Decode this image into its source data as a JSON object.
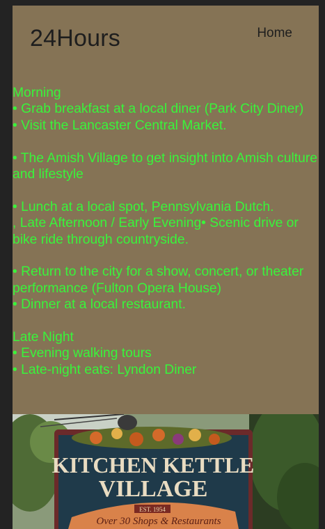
{
  "header": {
    "logo": "24Hours",
    "nav_home": "Home"
  },
  "itinerary": {
    "morning_heading": "Morning",
    "morning_1": "• Grab breakfast at a local diner (Park City Diner)",
    "morning_2": "• Visit the Lancaster Central Market.",
    "morning_3": "•  The Amish Village to get insight into Amish culture and lifestyle",
    "afternoon_1": "• Lunch at a local spot, Pennsylvania Dutch.",
    "afternoon_2": ", Late Afternoon / Early Evening• Scenic drive or bike ride through countryside.",
    "evening_1": "• Return to the city for a show, concert, or theater performance (Fulton Opera House)",
    "evening_2": "• Dinner at a local restaurant.",
    "late_heading": "Late Night",
    "late_1": "• Evening walking tours",
    "late_2": "• Late-night eats: Lyndon Diner"
  },
  "photo": {
    "sign_line1": "KITCHEN KETTLE",
    "sign_line2": "VILLAGE",
    "sign_est": "EST. 1954",
    "sign_banner": "Over 30 Shops & Restaurants"
  },
  "colors": {
    "page_bg": "#857355",
    "outer_bg": "#232323",
    "text_green": "#39f43b",
    "header_text": "#1e1e1e"
  }
}
